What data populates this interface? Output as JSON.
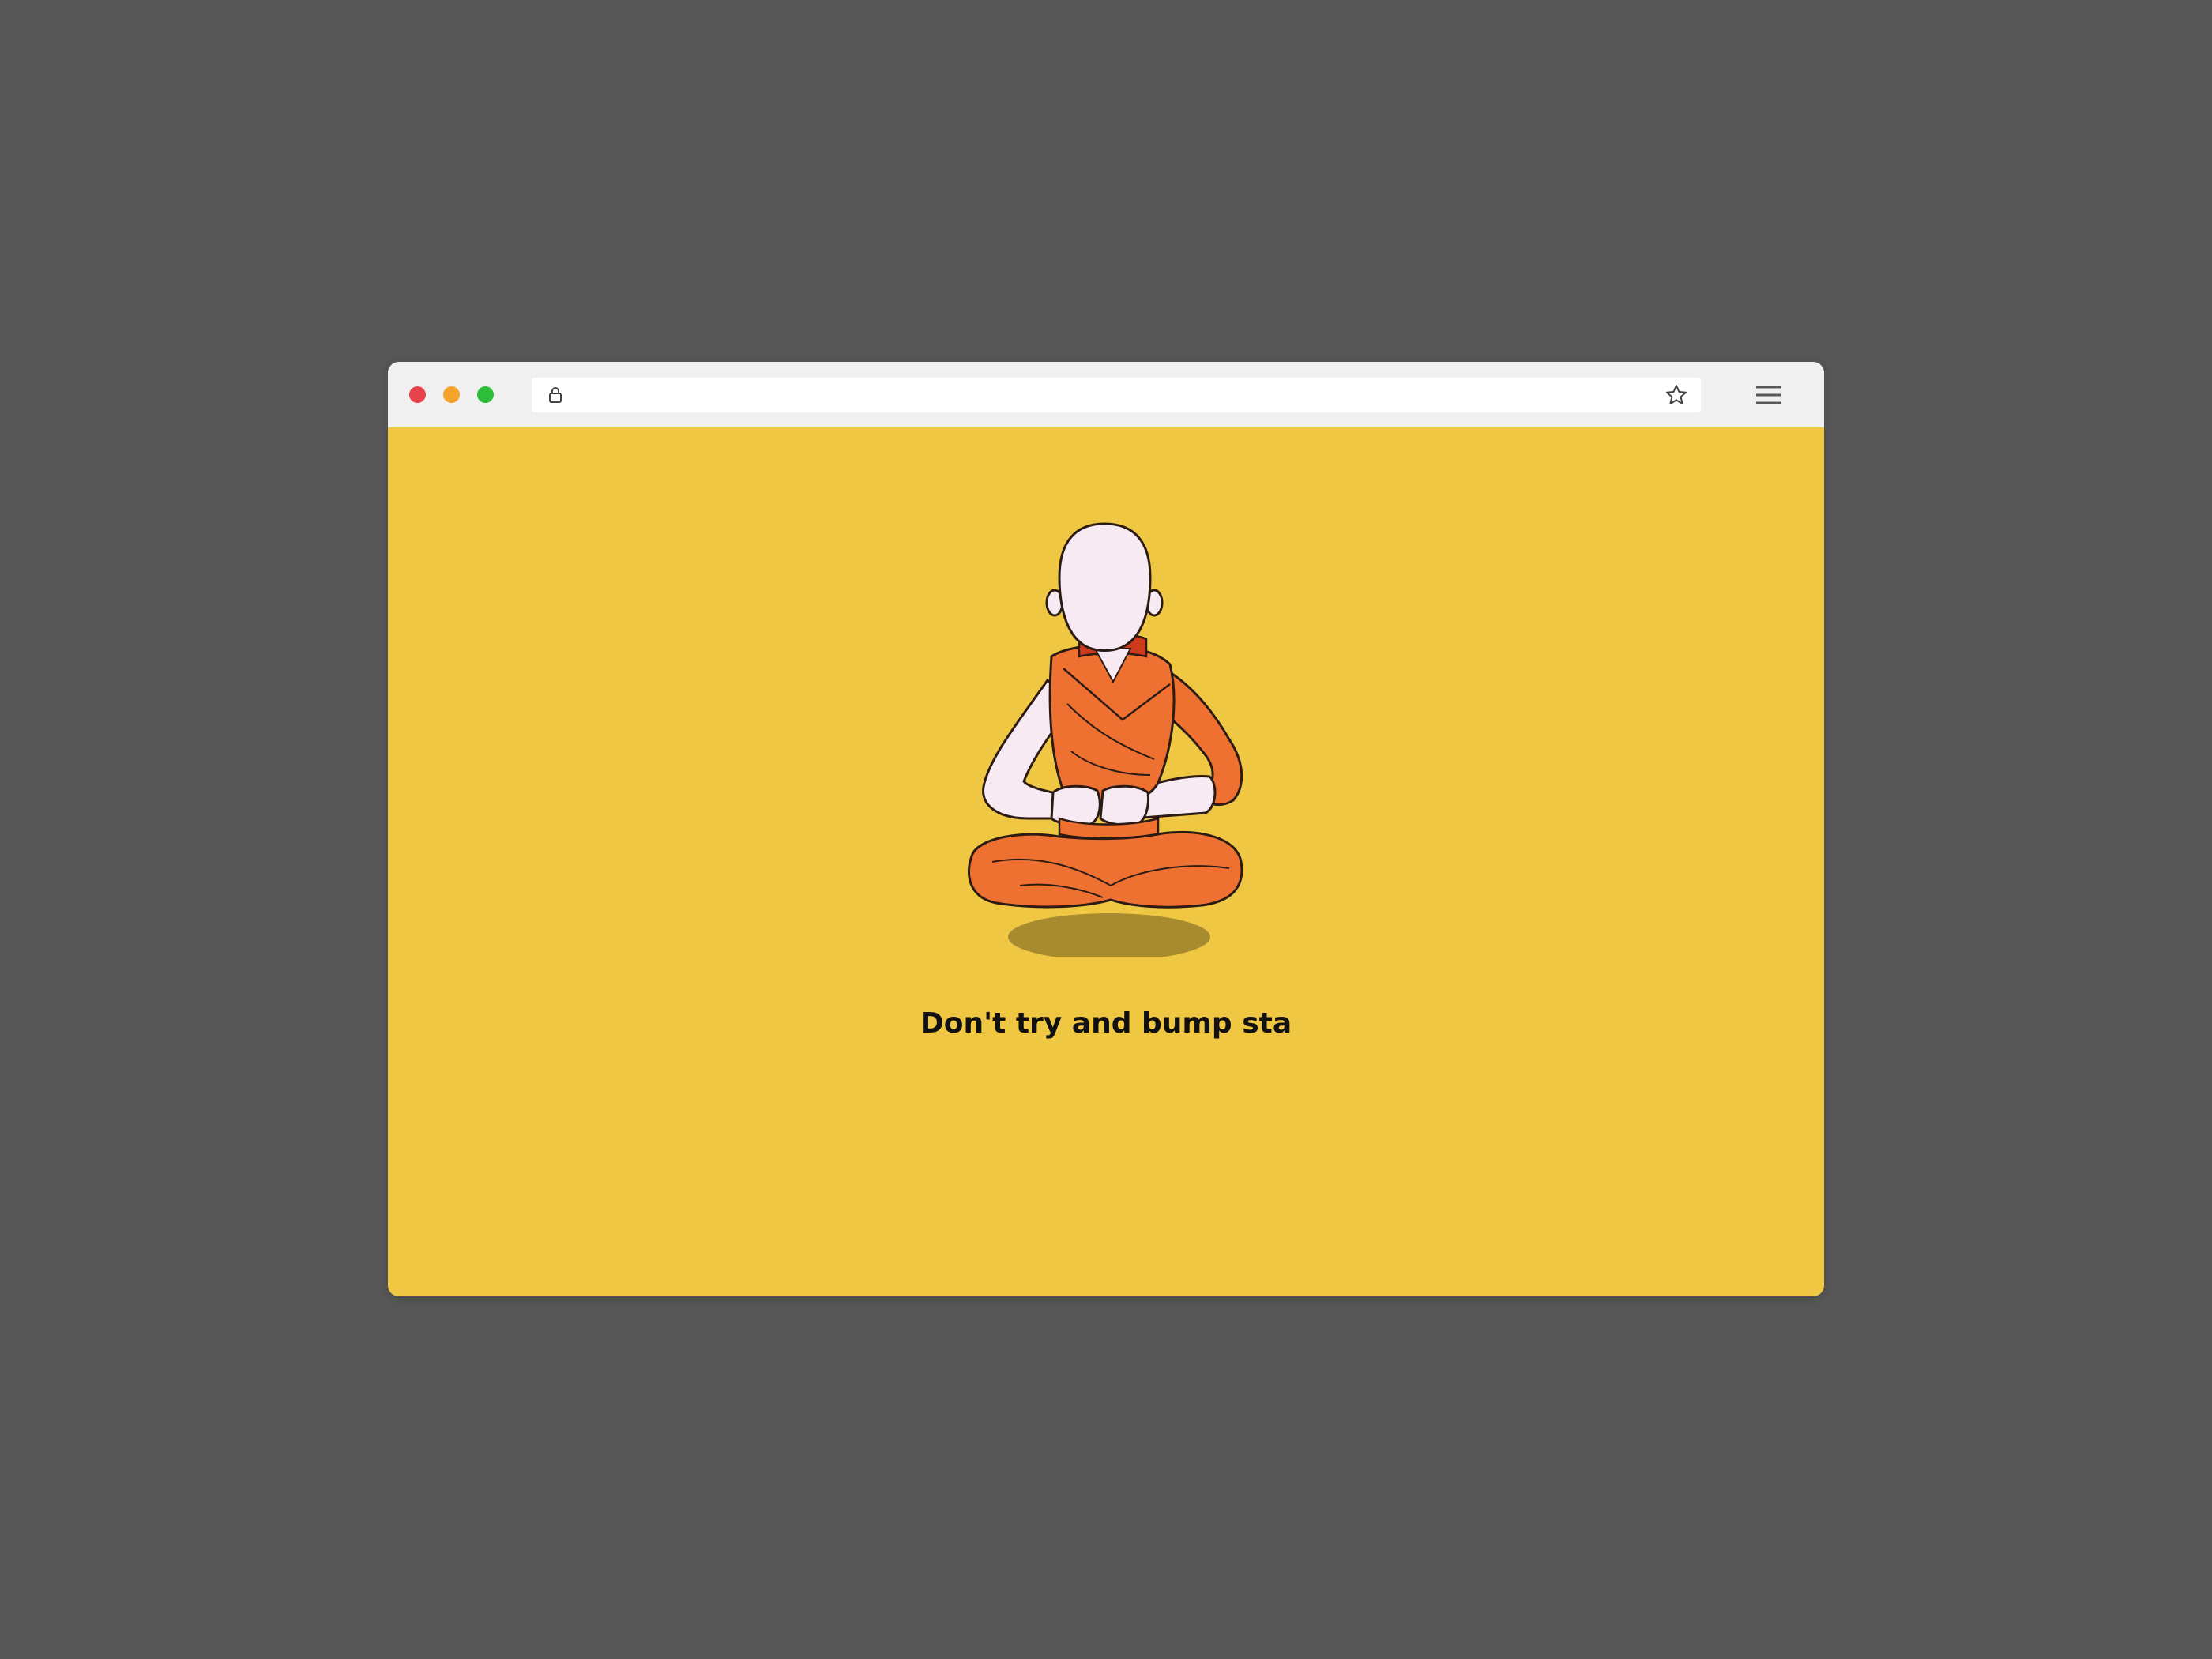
{
  "browser": {
    "url": "",
    "icons": {
      "lock": "lock-icon",
      "bookmark": "star-icon",
      "menu": "hamburger-menu-icon"
    }
  },
  "page": {
    "message": "Don't try and bump sta",
    "illustration": "meditating-monk-illustration"
  },
  "colors": {
    "desktop": "#565656",
    "page_background": "#f0c743",
    "robe": "#ee7131",
    "skin": "#f8eaf2",
    "shadow": "#a88a2f",
    "close": "#e8424b",
    "minimize": "#f4a32b",
    "maximize": "#2dbd3a"
  }
}
